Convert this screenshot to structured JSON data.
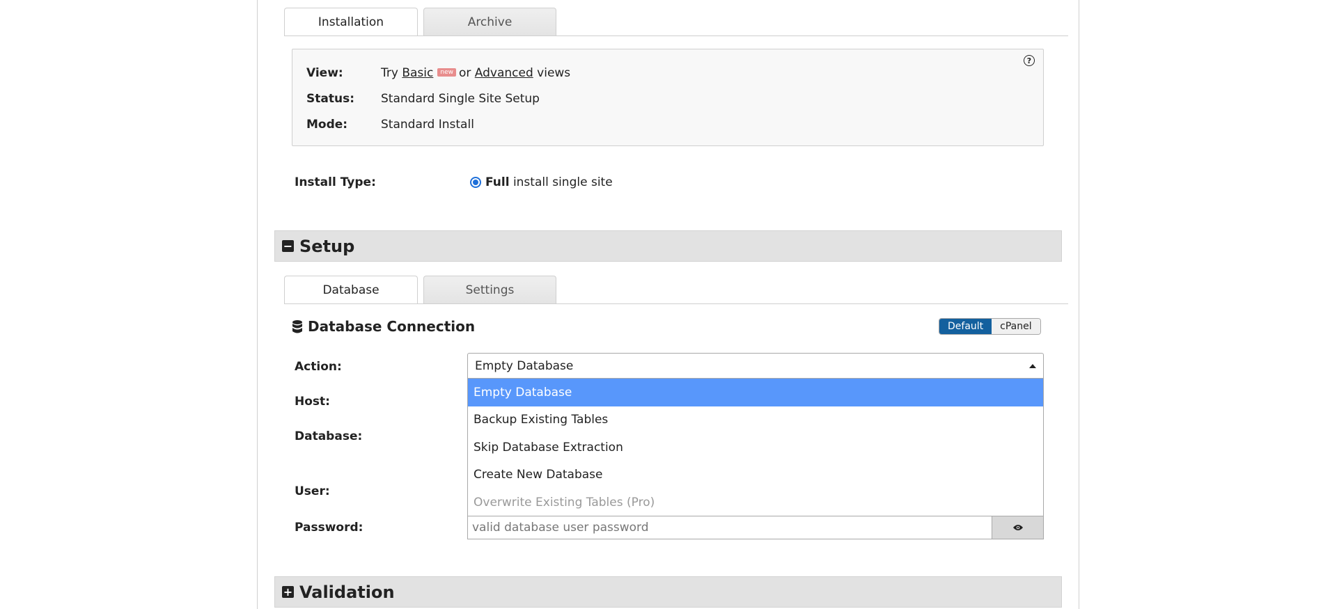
{
  "tabs_top": {
    "installation": "Installation",
    "archive": "Archive"
  },
  "info": {
    "view_key": "View:",
    "view_try": "Try",
    "view_basic": "Basic",
    "view_new_badge": "new",
    "view_or": "or",
    "view_advanced": "Advanced",
    "view_views": "views",
    "status_key": "Status:",
    "status_value": "Standard Single Site Setup",
    "mode_key": "Mode:",
    "mode_value": "Standard Install",
    "help_symbol": "?"
  },
  "install_type": {
    "label": "Install Type:",
    "option_bold": "Full",
    "option_rest": "install single site"
  },
  "setup": {
    "title": "Setup",
    "icon": "minus-square-icon",
    "icon_glyph": "−"
  },
  "tabs_setup": {
    "database": "Database",
    "settings": "Settings"
  },
  "db_connection": {
    "title": "Database Connection",
    "toggle_default": "Default",
    "toggle_cpanel": "cPanel"
  },
  "form": {
    "action_label": "Action:",
    "action_value": "Empty Database",
    "host_label": "Host:",
    "database_label": "Database:",
    "user_label": "User:",
    "password_label": "Password:",
    "password_placeholder": "valid database user password"
  },
  "action_options": [
    "Empty Database",
    "Backup Existing Tables",
    "Skip Database Extraction",
    "Create New Database",
    "Overwrite Existing Tables (Pro)"
  ],
  "validation": {
    "title": "Validation",
    "icon": "plus-square-icon",
    "icon_glyph": "+"
  },
  "colors": {
    "accent_blue": "#13609e",
    "selected_option": "#5897fb",
    "section_bg": "#e2e2e2"
  }
}
